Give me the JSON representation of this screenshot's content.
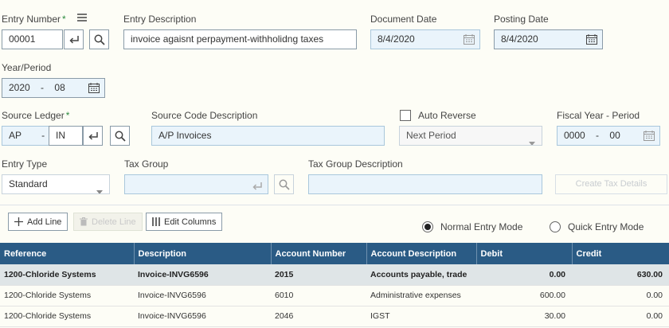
{
  "header": {
    "entry_number_label": "Entry Number",
    "required_mark": "*",
    "entry_number_value": "00001",
    "entry_description_label": "Entry Description",
    "entry_description_value": "invoice agaisnt perpayment-withholidng taxes",
    "document_date_label": "Document Date",
    "document_date_value": "8/4/2020",
    "posting_date_label": "Posting Date",
    "posting_date_value": "8/4/2020",
    "year_period_label": "Year/Period",
    "year_value": "2020",
    "period_sep": "-",
    "period_value": "08"
  },
  "source": {
    "source_ledger_label": "Source Ledger",
    "ledger_value": "AP",
    "ledger_sep": "-",
    "type_value": "IN",
    "source_code_desc_label": "Source Code Description",
    "source_code_desc_value": "A/P Invoices",
    "auto_reverse_label": "Auto Reverse",
    "auto_reverse_option": "Next Period",
    "fiscal_label": "Fiscal Year - Period",
    "fiscal_year_value": "0000",
    "fiscal_sep": "-",
    "fiscal_period_value": "00"
  },
  "entry": {
    "entry_type_label": "Entry Type",
    "entry_type_value": "Standard",
    "tax_group_label": "Tax Group",
    "tax_group_value": "",
    "tax_group_desc_label": "Tax Group Description",
    "tax_group_desc_value": "",
    "create_tax_details_label": "Create Tax Details"
  },
  "toolbar": {
    "add_line": "Add Line",
    "delete_line": "Delete Line",
    "edit_columns": "Edit Columns",
    "normal_mode": "Normal Entry Mode",
    "quick_mode": "Quick Entry Mode",
    "selected_mode": "normal"
  },
  "grid": {
    "columns": [
      "Reference",
      "Description",
      "Account Number",
      "Account Description",
      "Debit",
      "Credit"
    ],
    "rows": [
      {
        "reference": "1200-Chloride Systems",
        "description": "Invoice-INVG6596",
        "account_number": "2015",
        "account_description": "Accounts payable, trade",
        "debit": "0.00",
        "credit": "630.00"
      },
      {
        "reference": "1200-Chloride Systems",
        "description": "Invoice-INVG6596",
        "account_number": "6010",
        "account_description": "Administrative expenses",
        "debit": "600.00",
        "credit": "0.00"
      },
      {
        "reference": "1200-Chloride Systems",
        "description": "Invoice-INVG6596",
        "account_number": "2046",
        "account_description": "IGST",
        "debit": "30.00",
        "credit": "0.00"
      }
    ]
  },
  "colors": {
    "grid_header": "#2a5b85",
    "selected_row": "#dfe5e7",
    "required": "#2b8a3e"
  }
}
